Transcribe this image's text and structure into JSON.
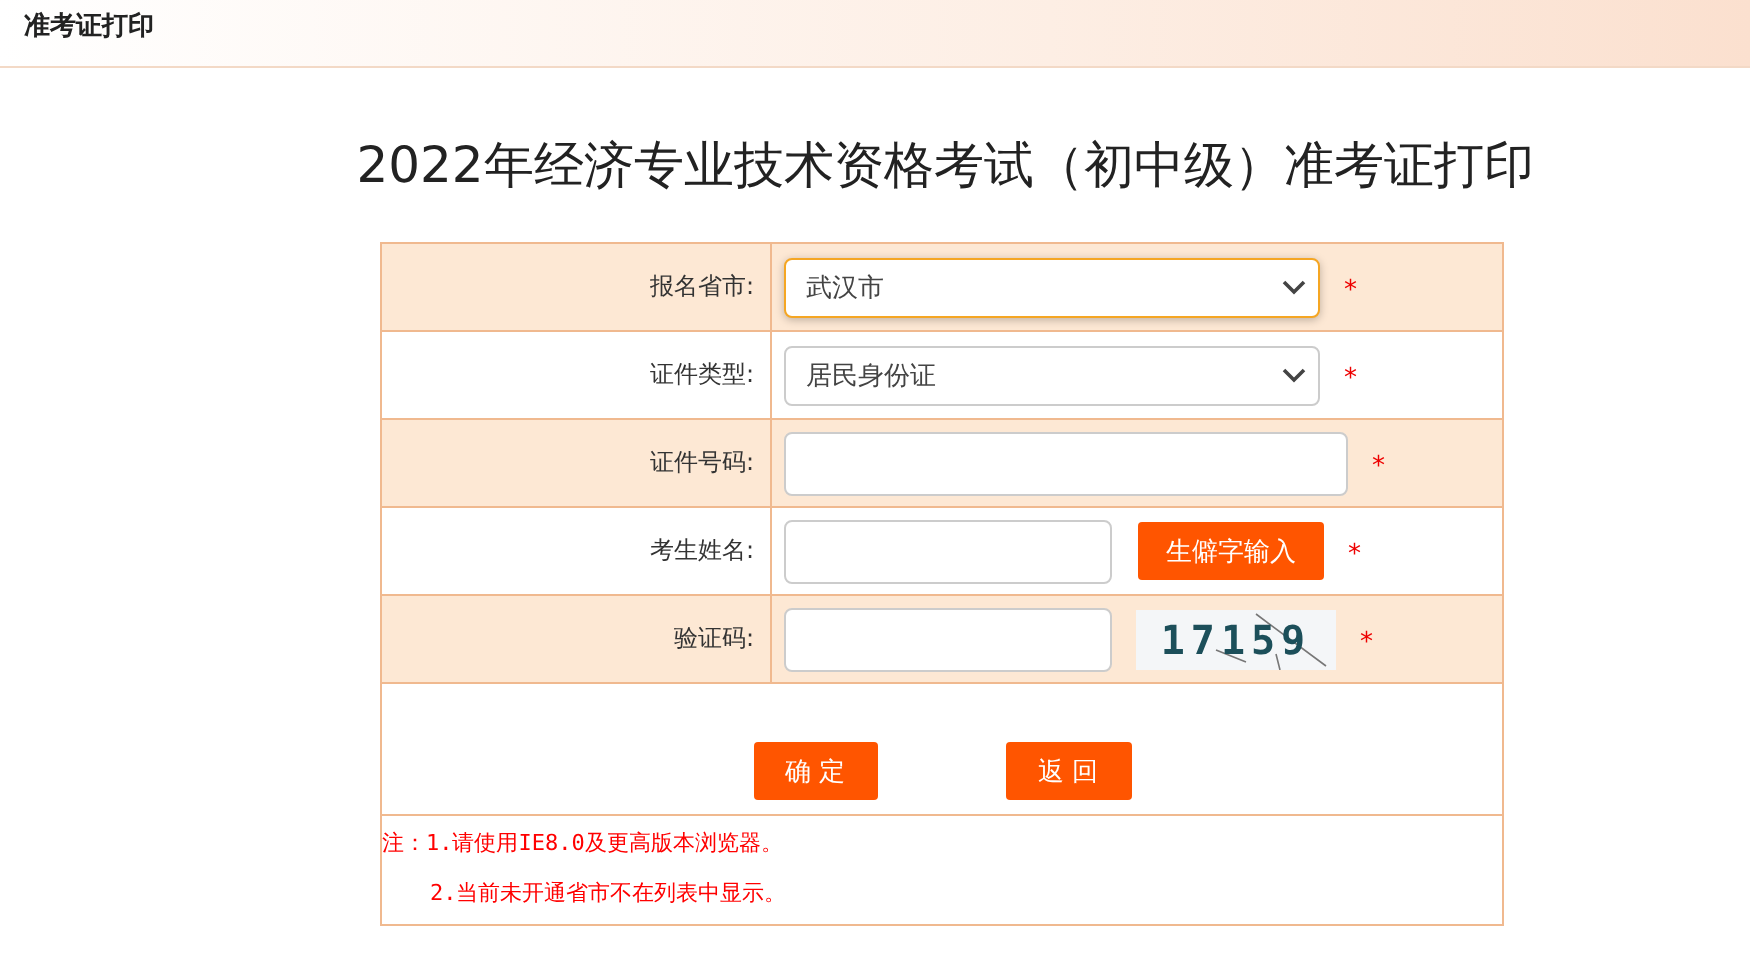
{
  "header": {
    "title": "准考证打印"
  },
  "page_title": "2022年经济专业技术资格考试（初中级）准考证打印",
  "form": {
    "rows": [
      {
        "label": "报名省市:",
        "kind": "select",
        "value": "武汉市",
        "focused": true,
        "required": "*"
      },
      {
        "label": "证件类型:",
        "kind": "select",
        "value": "居民身份证",
        "focused": false,
        "required": "*"
      },
      {
        "label": "证件号码:",
        "kind": "input",
        "value": "",
        "focused": false,
        "required": "*"
      },
      {
        "label": "考生姓名:",
        "kind": "input_button",
        "button": "生僻字输入",
        "focused": false,
        "required": "*"
      },
      {
        "label": "验证码:",
        "kind": "captcha",
        "captcha": "17159",
        "focused": false,
        "required": "*"
      }
    ],
    "buttons": [
      "确 定",
      "返 回"
    ],
    "notes": [
      "注：1.请使用IE8.0及更高版本浏览器。",
      "2.当前未开通省市不在列表中显示。"
    ]
  }
}
